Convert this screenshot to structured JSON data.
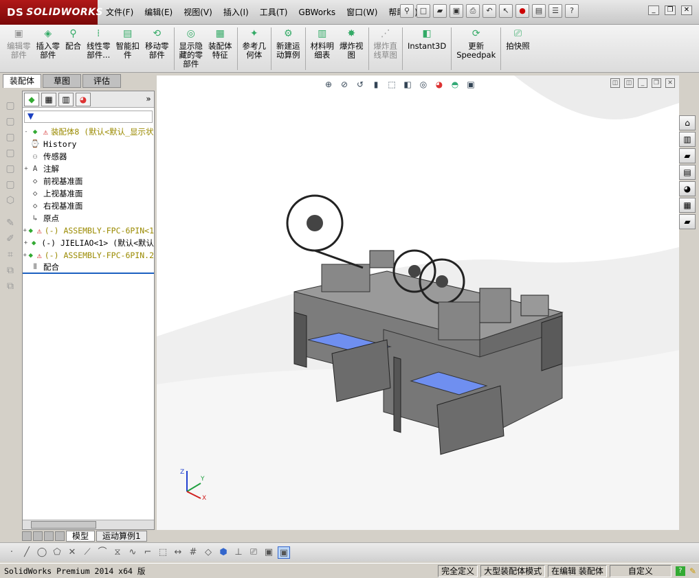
{
  "app": {
    "logo": "SOLIDWORKS",
    "logo_mark": "DS"
  },
  "menu": [
    "文件(F)",
    "编辑(E)",
    "视图(V)",
    "插入(I)",
    "工具(T)",
    "GBWorks",
    "窗口(W)",
    "帮助(H)"
  ],
  "command_manager": [
    {
      "label": "编辑零\n部件",
      "icon": "edit-component-icon",
      "disabled": true
    },
    {
      "label": "插入零\n部件",
      "icon": "insert-component-icon",
      "disabled": false
    },
    {
      "label": "配合",
      "icon": "mate-icon",
      "disabled": false
    },
    {
      "label": "线性零\n部件...",
      "icon": "linear-pattern-icon",
      "disabled": false
    },
    {
      "label": "智能扣\n件",
      "icon": "smart-fastener-icon",
      "disabled": false
    },
    {
      "label": "移动零\n部件",
      "icon": "move-component-icon",
      "disabled": false
    },
    {
      "label": "显示隐\n藏的零\n部件",
      "icon": "show-hidden-icon",
      "disabled": false
    },
    {
      "label": "装配体\n特征",
      "icon": "assembly-feature-icon",
      "disabled": false
    },
    {
      "label": "参考几\n何体",
      "icon": "reference-geometry-icon",
      "disabled": false
    },
    {
      "label": "新建运\n动算例",
      "icon": "motion-study-icon",
      "disabled": false
    },
    {
      "label": "材料明\n细表",
      "icon": "bom-icon",
      "disabled": false
    },
    {
      "label": "爆炸视\n图",
      "icon": "exploded-view-icon",
      "disabled": false
    },
    {
      "label": "爆炸直\n线草图",
      "icon": "explode-line-icon",
      "disabled": true
    },
    {
      "label": "Instant3D",
      "icon": "instant3d-icon",
      "disabled": false
    },
    {
      "label": "更新\nSpeedpak",
      "icon": "speedpak-icon",
      "disabled": false
    },
    {
      "label": "拍快照",
      "icon": "snapshot-icon",
      "disabled": false
    }
  ],
  "cm_tabs": [
    "装配体",
    "草图",
    "评估"
  ],
  "feature_tree": [
    {
      "label": "装配体8  (默认<默认_显示状",
      "icon": "assembly-icon",
      "warn": true,
      "expand": "-"
    },
    {
      "label": "History",
      "icon": "history-icon",
      "warn": false,
      "expand": ""
    },
    {
      "label": "传感器",
      "icon": "sensor-icon",
      "warn": false,
      "expand": ""
    },
    {
      "label": "注解",
      "icon": "annotation-icon",
      "warn": false,
      "expand": "+"
    },
    {
      "label": "前视基准面",
      "icon": "plane-icon",
      "warn": false,
      "expand": ""
    },
    {
      "label": "上视基准面",
      "icon": "plane-icon",
      "warn": false,
      "expand": ""
    },
    {
      "label": "右视基准面",
      "icon": "plane-icon",
      "warn": false,
      "expand": ""
    },
    {
      "label": "原点",
      "icon": "origin-icon",
      "warn": false,
      "expand": ""
    },
    {
      "label": "(-) ASSEMBLY-FPC-6PIN<1",
      "icon": "subassembly-icon",
      "warn": true,
      "expand": "+"
    },
    {
      "label": "(-) JIELIAO<1> (默认<默认",
      "icon": "subassembly-icon",
      "warn": false,
      "expand": "+"
    },
    {
      "label": "(-) ASSEMBLY-FPC-6PIN.2",
      "icon": "subassembly-icon",
      "warn": true,
      "expand": "+"
    },
    {
      "label": "配合",
      "icon": "mates-folder-icon",
      "warn": false,
      "expand": ""
    }
  ],
  "model_tabs": [
    "模型",
    "运动算例1"
  ],
  "status": {
    "app": "SolidWorks Premium 2014 x64 版",
    "cells": [
      "完全定义",
      "大型装配体模式",
      "在编辑 装配体"
    ],
    "units": "自定义"
  },
  "colors": {
    "accent": "#1a5fc0",
    "warning_text": "#9a8a00",
    "logo_red": "#a01010",
    "machine_gray": "#7c7c7c",
    "tray_blue": "#6f8ff0"
  }
}
